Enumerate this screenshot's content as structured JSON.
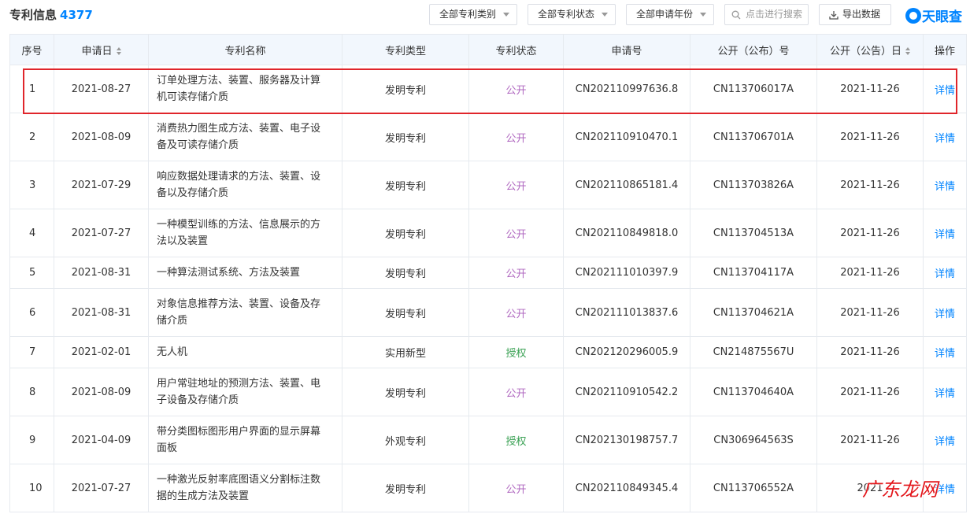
{
  "header": {
    "title": "专利信息",
    "count": "4377"
  },
  "filters": [
    "全部专利类别",
    "全部专利状态",
    "全部申请年份"
  ],
  "search": {
    "placeholder": "点击进行搜索"
  },
  "export_label": "导出数据",
  "logo_text": "天眼查",
  "columns": [
    "序号",
    "申请日",
    "专利名称",
    "专利类型",
    "专利状态",
    "申请号",
    "公开（公布）号",
    "公开（公告）日",
    "操作"
  ],
  "rows": [
    {
      "no": "1",
      "date": "2021-08-27",
      "name": [
        "订单处理方法、装置、服务器及计算",
        "机可读存储介质"
      ],
      "type": "发明专利",
      "status": "公开",
      "app_no": "CN202110997636.8",
      "pub_no": "CN113706017A",
      "pub_date": "2021-11-26",
      "action": "详情"
    },
    {
      "no": "2",
      "date": "2021-08-09",
      "name": [
        "消费热力图生成方法、装置、电子设",
        "备及可读存储介质"
      ],
      "type": "发明专利",
      "status": "公开",
      "app_no": "CN202110910470.1",
      "pub_no": "CN113706701A",
      "pub_date": "2021-11-26",
      "action": "详情"
    },
    {
      "no": "3",
      "date": "2021-07-29",
      "name": [
        "响应数据处理请求的方法、装置、设",
        "备以及存储介质"
      ],
      "type": "发明专利",
      "status": "公开",
      "app_no": "CN202110865181.4",
      "pub_no": "CN113703826A",
      "pub_date": "2021-11-26",
      "action": "详情"
    },
    {
      "no": "4",
      "date": "2021-07-27",
      "name": [
        "一种模型训练的方法、信息展示的方",
        "法以及装置"
      ],
      "type": "发明专利",
      "status": "公开",
      "app_no": "CN202110849818.0",
      "pub_no": "CN113704513A",
      "pub_date": "2021-11-26",
      "action": "详情"
    },
    {
      "no": "5",
      "date": "2021-08-31",
      "name": [
        "一种算法测试系统、方法及装置"
      ],
      "type": "发明专利",
      "status": "公开",
      "app_no": "CN202111010397.9",
      "pub_no": "CN113704117A",
      "pub_date": "2021-11-26",
      "action": "详情"
    },
    {
      "no": "6",
      "date": "2021-08-31",
      "name": [
        "对象信息推荐方法、装置、设备及存",
        "储介质"
      ],
      "type": "发明专利",
      "status": "公开",
      "app_no": "CN202111013837.6",
      "pub_no": "CN113704621A",
      "pub_date": "2021-11-26",
      "action": "详情"
    },
    {
      "no": "7",
      "date": "2021-02-01",
      "name": [
        "无人机"
      ],
      "type": "实用新型",
      "status": "授权",
      "app_no": "CN202120296005.9",
      "pub_no": "CN214875567U",
      "pub_date": "2021-11-26",
      "action": "详情"
    },
    {
      "no": "8",
      "date": "2021-08-09",
      "name": [
        "用户常驻地址的预测方法、装置、电",
        "子设备及存储介质"
      ],
      "type": "发明专利",
      "status": "公开",
      "app_no": "CN202110910542.2",
      "pub_no": "CN113704640A",
      "pub_date": "2021-11-26",
      "action": "详情"
    },
    {
      "no": "9",
      "date": "2021-04-09",
      "name": [
        "带分类图标图形用户界面的显示屏幕",
        "面板"
      ],
      "type": "外观专利",
      "status": "授权",
      "app_no": "CN202130198757.7",
      "pub_no": "CN306964563S",
      "pub_date": "2021-11-26",
      "action": "详情"
    },
    {
      "no": "10",
      "date": "2021-07-27",
      "name": [
        "一种激光反射率底图语义分割标注数",
        "据的生成方法及装置"
      ],
      "type": "发明专利",
      "status": "公开",
      "app_no": "CN202110849345.4",
      "pub_no": "CN113706552A",
      "pub_date": "2021",
      "action": "详情"
    }
  ],
  "watermark": "广东龙网"
}
